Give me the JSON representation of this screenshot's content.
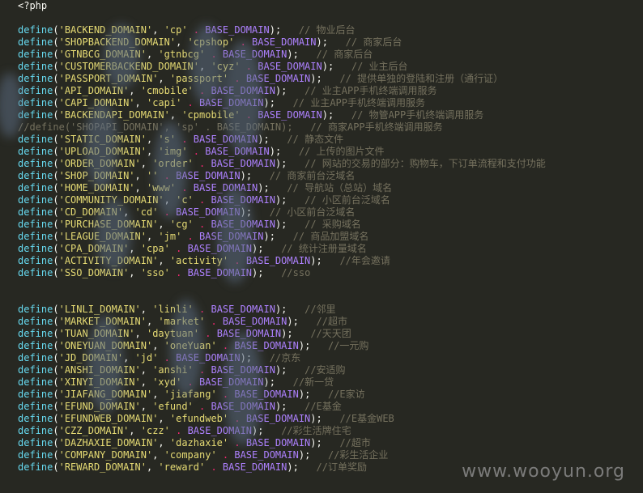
{
  "editor": {
    "php_open": "<?php",
    "keyword": "define",
    "base_const": "BASE_DOMAIN",
    "group1": [
      {
        "name": "BACKEND_DOMAIN",
        "value": "cp",
        "comment": "// 物业后台"
      },
      {
        "name": "SHOPBACKEND_DOMAIN",
        "value": "cpshop",
        "comment": "// 商家后台"
      },
      {
        "name": "GTNBCG_DOMAIN",
        "value": "gtnbcg",
        "comment": "// 商家后台"
      },
      {
        "name": "CUSTOMERBACKEND_DOMAIN",
        "value": "cyz",
        "comment": "// 业主后台"
      },
      {
        "name": "PASSPORT_DOMAIN",
        "value": "passport",
        "comment": "// 提供单独的登陆和注册（通行证）"
      },
      {
        "name": "API_DOMAIN",
        "value": "cmobile",
        "comment": "// 业主APP手机终端调用服务"
      },
      {
        "name": "CAPI_DOMAIN",
        "value": "capi",
        "comment": "// 业主APP手机终端调用服务"
      },
      {
        "name": "BACKENDAPI_DOMAIN",
        "value": "cpmobile",
        "comment": "// 物管APP手机终端调用服务"
      },
      {
        "name": "SHOPAPI_DOMAIN",
        "value": "sp",
        "comment": "// 商家APP手机终端调用服务",
        "commented": true
      },
      {
        "name": "STATIC_DOMAIN",
        "value": "s",
        "comment": "// 静态文件"
      },
      {
        "name": "UPLOAD_DOMAIN",
        "value": "img",
        "comment": "// 上传的图片文件"
      },
      {
        "name": "ORDER_DOMAIN",
        "value": "order",
        "comment": "// 网站的交易的部分：购物车，下订单流程和支付功能"
      },
      {
        "name": "SHOP_DOMAIN",
        "value": "",
        "comment": "// 商家前台泛域名"
      },
      {
        "name": "HOME_DOMAIN",
        "value": "www",
        "comment": "// 导航站（总站）域名"
      },
      {
        "name": "COMMUNITY_DOMAIN",
        "value": "c",
        "comment": "// 小区前台泛域名"
      },
      {
        "name": "CD_DOMAIN",
        "value": "cd",
        "comment": "// 小区前台泛域名"
      },
      {
        "name": "PURCHASE_DOMAIN",
        "value": "cg",
        "comment": "// 采购域名"
      },
      {
        "name": "LEAGUE_DOMAIN",
        "value": "jm",
        "comment": "// 商品加盟域名"
      },
      {
        "name": "CPA_DOMAIN",
        "value": "cpa",
        "comment": "// 统计注册量域名"
      },
      {
        "name": "ACTIVITY_DOMAIN",
        "value": "activity",
        "comment": "//年会邀请"
      },
      {
        "name": "SSO_DOMAIN",
        "value": "sso",
        "comment": "//sso"
      }
    ],
    "group2": [
      {
        "name": "LINLI_DOMAIN",
        "value": "linli",
        "comment": "//邻里"
      },
      {
        "name": "MARKET_DOMAIN",
        "value": "market",
        "comment": "//超市"
      },
      {
        "name": "TUAN_DOMAIN",
        "value": "daytuan",
        "comment": "//天天团"
      },
      {
        "name": "ONEYUAN_DOMAIN",
        "value": "oneYuan",
        "comment": "//一元购"
      },
      {
        "name": "JD_DOMAIN",
        "value": "jd",
        "comment": "//京东"
      },
      {
        "name": "ANSHI_DOMAIN",
        "value": "anshi",
        "comment": "//安适购"
      },
      {
        "name": "XINYI_DOMAIN",
        "value": "xyd",
        "comment": "//新一贷"
      },
      {
        "name": "JIAFANG_DOMAIN",
        "value": "jiafang",
        "comment": "//E家访"
      },
      {
        "name": "EFUND_DOMAIN",
        "value": "efund",
        "comment": "//E基金"
      },
      {
        "name": "EFUNDWEB_DOMAIN",
        "value": "efundweb",
        "comment": "//E基金WEB"
      },
      {
        "name": "CZZ_DOMAIN",
        "value": "czz",
        "comment": "//彩生活牌住宅"
      },
      {
        "name": "DAZHAXIE_DOMAIN",
        "value": "dazhaxie",
        "comment": "//超市"
      },
      {
        "name": "COMPANY_DOMAIN",
        "value": "company",
        "comment": "//彩生活企业"
      },
      {
        "name": "REWARD_DOMAIN",
        "value": "reward",
        "comment": "//订单奖励"
      }
    ]
  },
  "watermark": "www.wooyun.org"
}
